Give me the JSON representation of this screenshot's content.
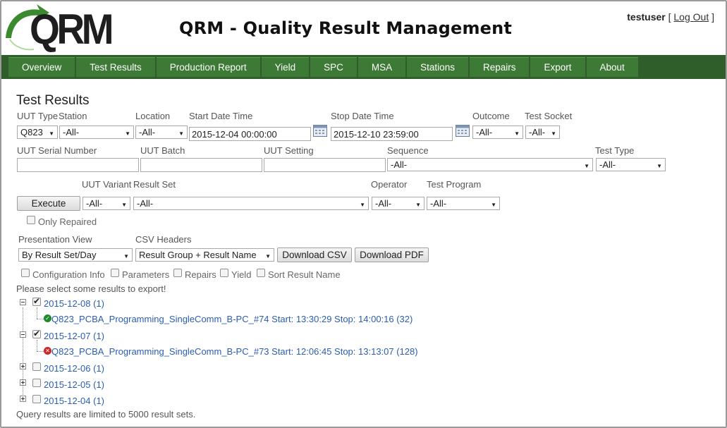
{
  "header": {
    "logo_text": "QRM",
    "title": "QRM - Quality Result Management",
    "username": "testuser",
    "bracket_open": "[",
    "logout_label": "Log Out",
    "bracket_close": "]",
    "logo_colors": {
      "arrow": "#3c8a2e",
      "text": "#1e1e1e"
    }
  },
  "nav": [
    "Overview",
    "Test Results",
    "Production Report",
    "Yield",
    "SPC",
    "MSA",
    "Stations",
    "Repairs",
    "Export",
    "About"
  ],
  "page": {
    "title": "Test Results"
  },
  "filters": {
    "uut_type": {
      "label": "UUT Type",
      "value": "Q823"
    },
    "station": {
      "label": "Station",
      "value": "-All-"
    },
    "location": {
      "label": "Location",
      "value": "-All-"
    },
    "start_date": {
      "label": "Start Date Time",
      "value": "2015-12-04 00:00:00"
    },
    "stop_date": {
      "label": "Stop Date Time",
      "value": "2015-12-10 23:59:00"
    },
    "outcome": {
      "label": "Outcome",
      "value": "-All-"
    },
    "test_socket": {
      "label": "Test Socket",
      "value": "-All-"
    },
    "uut_serial": {
      "label": "UUT Serial Number",
      "value": ""
    },
    "uut_batch": {
      "label": "UUT Batch",
      "value": ""
    },
    "uut_setting": {
      "label": "UUT Setting",
      "value": ""
    },
    "sequence": {
      "label": "Sequence",
      "value": "-All-"
    },
    "test_type": {
      "label": "Test Type",
      "value": "-All-"
    },
    "uut_variant": {
      "label": "UUT Variant",
      "value": "-All-"
    },
    "result_set": {
      "label": "Result Set",
      "value": "-All-"
    },
    "operator": {
      "label": "Operator",
      "value": "-All-"
    },
    "test_program": {
      "label": "Test Program",
      "value": "-All-"
    },
    "execute_label": "Execute",
    "only_repaired_label": "Only Repaired"
  },
  "presentation": {
    "view_label": "Presentation View",
    "view_value": "By Result Set/Day",
    "csv_label": "CSV Headers",
    "csv_value": "Result Group + Result Name",
    "download_csv": "Download CSV",
    "download_pdf": "Download PDF"
  },
  "options": [
    "Configuration Info",
    "Parameters",
    "Repairs",
    "Yield",
    "Sort Result Name"
  ],
  "message": "Please select some results to export!",
  "tree": [
    {
      "date": "2015-12-08 (1)",
      "checked": true,
      "expanded": true,
      "child": "Q823_PCBA_Programming_SingleComm_B-PC_#74 Start: 13:30:29 Stop: 14:00:16 (32)",
      "status": "pass"
    },
    {
      "date": "2015-12-07 (1)",
      "checked": true,
      "expanded": true,
      "child": "Q823_PCBA_Programming_SingleComm_B-PC_#73 Start: 12:06:45 Stop: 13:13:07 (128)",
      "status": "fail"
    },
    {
      "date": "2015-12-06 (1)",
      "checked": false,
      "expanded": false
    },
    {
      "date": "2015-12-05 (1)",
      "checked": false,
      "expanded": false
    },
    {
      "date": "2015-12-04 (1)",
      "checked": false,
      "expanded": false
    }
  ],
  "footer_note": "Query results are limited to 5000 result sets.",
  "colors": {
    "nav_bg": "#2f5e2a",
    "nav_item": "#3d7a35",
    "link": "#2a5db0",
    "pass": "#1f8a2b",
    "fail": "#cc2a2a"
  }
}
